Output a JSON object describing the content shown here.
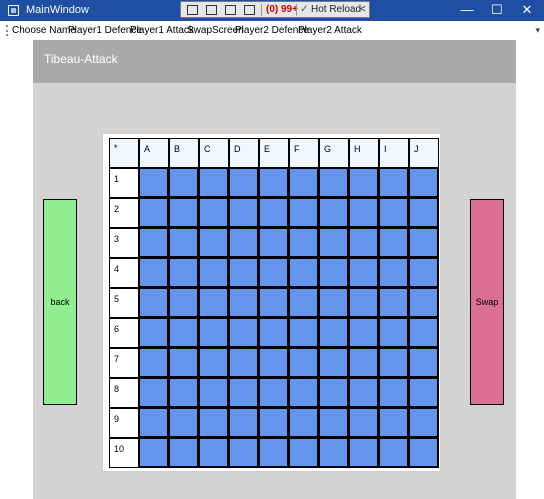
{
  "window": {
    "title": "MainWindow",
    "minimize": "—",
    "maximize": "☐",
    "close": "✕"
  },
  "devtools": {
    "badge": "(0) 99+",
    "hot_reload": "Hot Reload",
    "collapse": "<"
  },
  "menu": {
    "items": [
      "Choose Name",
      "Player1 Defence",
      "Player1 Attack",
      "SwapScreen",
      "Player2 Defence",
      "Player2 Attack"
    ],
    "overflow": "▾"
  },
  "header": {
    "title": "Tibeau-Attack"
  },
  "buttons": {
    "back": "back",
    "swap": "Swap"
  },
  "grid": {
    "corner": "*",
    "columns": [
      "A",
      "B",
      "C",
      "D",
      "E",
      "F",
      "G",
      "H",
      "I",
      "J"
    ],
    "rows": [
      "1",
      "2",
      "3",
      "4",
      "5",
      "6",
      "7",
      "8",
      "9",
      "10"
    ],
    "cell_color": "#6495ed"
  },
  "colors": {
    "header": "#a9a9a9",
    "background": "#d3d3d3",
    "back_button": "#90ee90",
    "swap_button": "#db7093",
    "titlebar": "#1f4fa3"
  }
}
